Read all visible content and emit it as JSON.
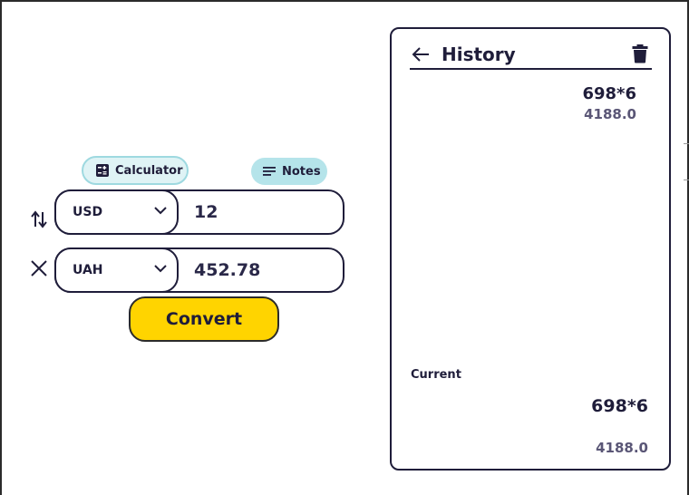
{
  "toolbar": {
    "calculator_label": "Calculator",
    "notes_label": "Notes"
  },
  "converter": {
    "from": {
      "currency": "USD",
      "amount": "12"
    },
    "to": {
      "currency": "UAH",
      "amount": "452.78"
    },
    "convert_label": "Convert"
  },
  "history": {
    "title": "History",
    "items": [
      {
        "expression": "698*6",
        "result": "4188.0"
      }
    ],
    "current_label": "Current",
    "current": {
      "expression": "698*6",
      "result": "4188.0"
    }
  },
  "colors": {
    "accent_yellow": "#ffd400",
    "ink": "#1f1d3a",
    "pill_light": "#dff3f5",
    "pill_teal": "#b5e4ea",
    "muted_text": "#5a5676"
  },
  "icons": [
    "calculator-icon",
    "notes-icon",
    "swap-icon",
    "close-icon",
    "chevron-down-icon",
    "back-arrow-icon",
    "trash-icon"
  ]
}
